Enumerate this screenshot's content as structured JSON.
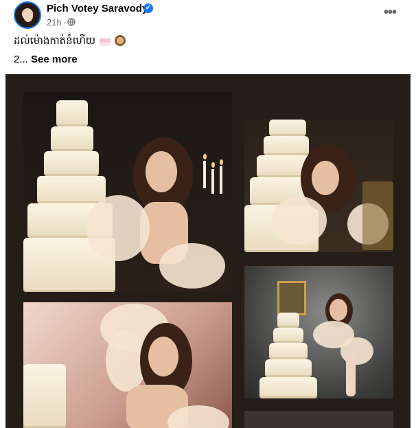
{
  "post": {
    "author": "Pich Votey Saravody",
    "time": "21h",
    "caption_text": "ដល់ម៉ោងកាត់នំហើយ",
    "body_text": "2...",
    "see_more": "See more"
  },
  "icons": {
    "verified": "verified-badge-icon",
    "audience": "globe-icon",
    "menu": "more-options-icon",
    "emoji1": "birthday-cake-emoji",
    "emoji2": "see-no-evil-monkey-emoji"
  },
  "colors": {
    "brand": "#1877f2",
    "text": "#050505",
    "secondary": "#65676b",
    "media_bg": "#241d18"
  }
}
